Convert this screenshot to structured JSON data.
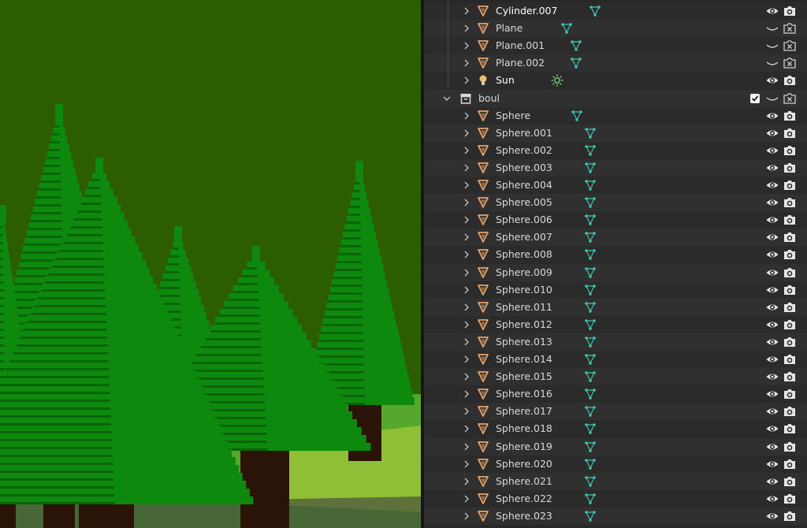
{
  "viewport": {
    "sky_color": "#2c5d00",
    "ground_color": "#55a82b",
    "tree_color": "#0d8a0d",
    "tree_shadow_color": "#0a5a0a",
    "trunk_color": "#2a1408"
  },
  "outliner": {
    "rows": [
      {
        "label": "Cylinder.007",
        "kind": "mesh",
        "bright": true,
        "visible": true,
        "indent": 1
      },
      {
        "label": "Plane",
        "kind": "mesh",
        "bright": false,
        "visible": false,
        "indent": 1
      },
      {
        "label": "Plane.001",
        "kind": "mesh",
        "bright": false,
        "visible": false,
        "indent": 1
      },
      {
        "label": "Plane.002",
        "kind": "mesh",
        "bright": false,
        "visible": false,
        "indent": 1
      },
      {
        "label": "Sun",
        "kind": "light",
        "bright": true,
        "visible": true,
        "indent": 1
      },
      {
        "label": "boul",
        "kind": "collection",
        "bright": false,
        "visible": false,
        "indent": 0
      },
      {
        "label": "Sphere",
        "kind": "mesh",
        "bright": false,
        "visible": true,
        "indent": 1
      },
      {
        "label": "Sphere.001",
        "kind": "mesh",
        "bright": false,
        "visible": true,
        "indent": 1
      },
      {
        "label": "Sphere.002",
        "kind": "mesh",
        "bright": false,
        "visible": true,
        "indent": 1
      },
      {
        "label": "Sphere.003",
        "kind": "mesh",
        "bright": false,
        "visible": true,
        "indent": 1
      },
      {
        "label": "Sphere.004",
        "kind": "mesh",
        "bright": false,
        "visible": true,
        "indent": 1
      },
      {
        "label": "Sphere.005",
        "kind": "mesh",
        "bright": false,
        "visible": true,
        "indent": 1
      },
      {
        "label": "Sphere.006",
        "kind": "mesh",
        "bright": false,
        "visible": true,
        "indent": 1
      },
      {
        "label": "Sphere.007",
        "kind": "mesh",
        "bright": false,
        "visible": true,
        "indent": 1
      },
      {
        "label": "Sphere.008",
        "kind": "mesh",
        "bright": false,
        "visible": true,
        "indent": 1
      },
      {
        "label": "Sphere.009",
        "kind": "mesh",
        "bright": false,
        "visible": true,
        "indent": 1
      },
      {
        "label": "Sphere.010",
        "kind": "mesh",
        "bright": false,
        "visible": true,
        "indent": 1
      },
      {
        "label": "Sphere.011",
        "kind": "mesh",
        "bright": false,
        "visible": true,
        "indent": 1
      },
      {
        "label": "Sphere.012",
        "kind": "mesh",
        "bright": false,
        "visible": true,
        "indent": 1
      },
      {
        "label": "Sphere.013",
        "kind": "mesh",
        "bright": false,
        "visible": true,
        "indent": 1
      },
      {
        "label": "Sphere.014",
        "kind": "mesh",
        "bright": false,
        "visible": true,
        "indent": 1
      },
      {
        "label": "Sphere.015",
        "kind": "mesh",
        "bright": false,
        "visible": true,
        "indent": 1
      },
      {
        "label": "Sphere.016",
        "kind": "mesh",
        "bright": false,
        "visible": true,
        "indent": 1
      },
      {
        "label": "Sphere.017",
        "kind": "mesh",
        "bright": false,
        "visible": true,
        "indent": 1
      },
      {
        "label": "Sphere.018",
        "kind": "mesh",
        "bright": false,
        "visible": true,
        "indent": 1
      },
      {
        "label": "Sphere.019",
        "kind": "mesh",
        "bright": false,
        "visible": true,
        "indent": 1
      },
      {
        "label": "Sphere.020",
        "kind": "mesh",
        "bright": false,
        "visible": true,
        "indent": 1
      },
      {
        "label": "Sphere.021",
        "kind": "mesh",
        "bright": false,
        "visible": true,
        "indent": 1
      },
      {
        "label": "Sphere.022",
        "kind": "mesh",
        "bright": false,
        "visible": true,
        "indent": 1
      },
      {
        "label": "Sphere.023",
        "kind": "mesh",
        "bright": false,
        "visible": true,
        "indent": 1
      }
    ],
    "colors": {
      "mesh_icon": "#e8a46b",
      "mesh_data_icon": "#3fc2b0",
      "light_icon": "#e8c070",
      "sun_data_icon": "#7fd17f"
    }
  }
}
